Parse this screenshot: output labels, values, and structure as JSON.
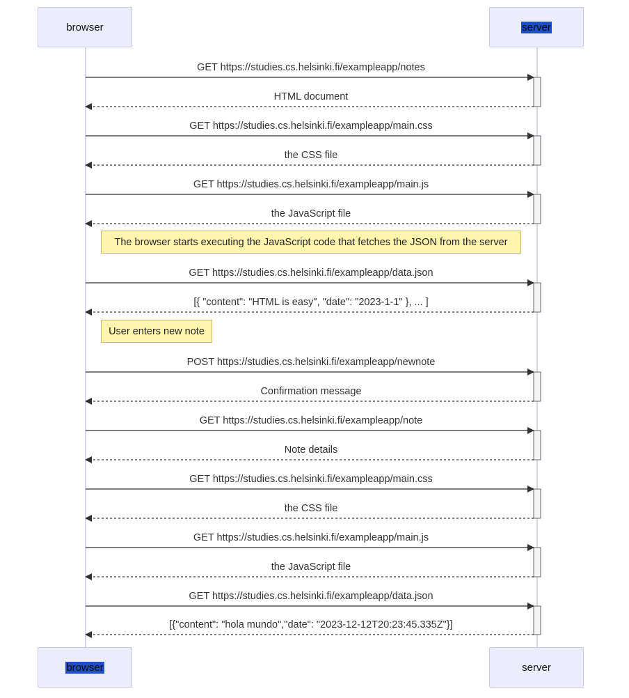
{
  "participants": {
    "browser": "browser",
    "server": "server"
  },
  "messages": [
    {
      "from": "browser",
      "to": "server",
      "type": "request",
      "label": "GET https://studies.cs.helsinki.fi/exampleapp/notes"
    },
    {
      "from": "server",
      "to": "browser",
      "type": "response",
      "label": "HTML document"
    },
    {
      "from": "browser",
      "to": "server",
      "type": "request",
      "label": "GET https://studies.cs.helsinki.fi/exampleapp/main.css"
    },
    {
      "from": "server",
      "to": "browser",
      "type": "response",
      "label": "the CSS file"
    },
    {
      "from": "browser",
      "to": "server",
      "type": "request",
      "label": "GET https://studies.cs.helsinki.fi/exampleapp/main.js"
    },
    {
      "from": "server",
      "to": "browser",
      "type": "response",
      "label": "the JavaScript file"
    },
    {
      "from": "browser",
      "to": "server",
      "type": "request",
      "label": "GET https://studies.cs.helsinki.fi/exampleapp/data.json"
    },
    {
      "from": "server",
      "to": "browser",
      "type": "response",
      "label": "[{ \"content\": \"HTML is easy\", \"date\": \"2023-1-1\" }, ... ]"
    },
    {
      "from": "browser",
      "to": "server",
      "type": "request",
      "label": "POST https://studies.cs.helsinki.fi/exampleapp/newnote"
    },
    {
      "from": "server",
      "to": "browser",
      "type": "response",
      "label": "Confirmation message"
    },
    {
      "from": "browser",
      "to": "server",
      "type": "request",
      "label": "GET https://studies.cs.helsinki.fi/exampleapp/note"
    },
    {
      "from": "server",
      "to": "browser",
      "type": "response",
      "label": "Note details"
    },
    {
      "from": "browser",
      "to": "server",
      "type": "request",
      "label": "GET https://studies.cs.helsinki.fi/exampleapp/main.css"
    },
    {
      "from": "server",
      "to": "browser",
      "type": "response",
      "label": "the CSS file"
    },
    {
      "from": "browser",
      "to": "server",
      "type": "request",
      "label": "GET https://studies.cs.helsinki.fi/exampleapp/main.js"
    },
    {
      "from": "server",
      "to": "browser",
      "type": "response",
      "label": "the JavaScript file"
    },
    {
      "from": "browser",
      "to": "server",
      "type": "request",
      "label": "GET https://studies.cs.helsinki.fi/exampleapp/data.json"
    },
    {
      "from": "server",
      "to": "browser",
      "type": "response",
      "label": "[{\"content\": \"hola mundo\",\"date\": \"2023-12-12T20:23:45.335Z\"}]"
    }
  ],
  "notes": [
    {
      "text": "The browser starts executing the JavaScript code that fetches the JSON from the server"
    },
    {
      "text": "User enters new note"
    }
  ],
  "colors": {
    "actor_fill": "#ececff",
    "actor_border": "#c7c7e8",
    "lifeline": "#c7c7e8",
    "note_fill": "#fff5ad",
    "note_border": "#c8b95a",
    "arrow": "#333333",
    "selection": "#1f4fc4"
  }
}
